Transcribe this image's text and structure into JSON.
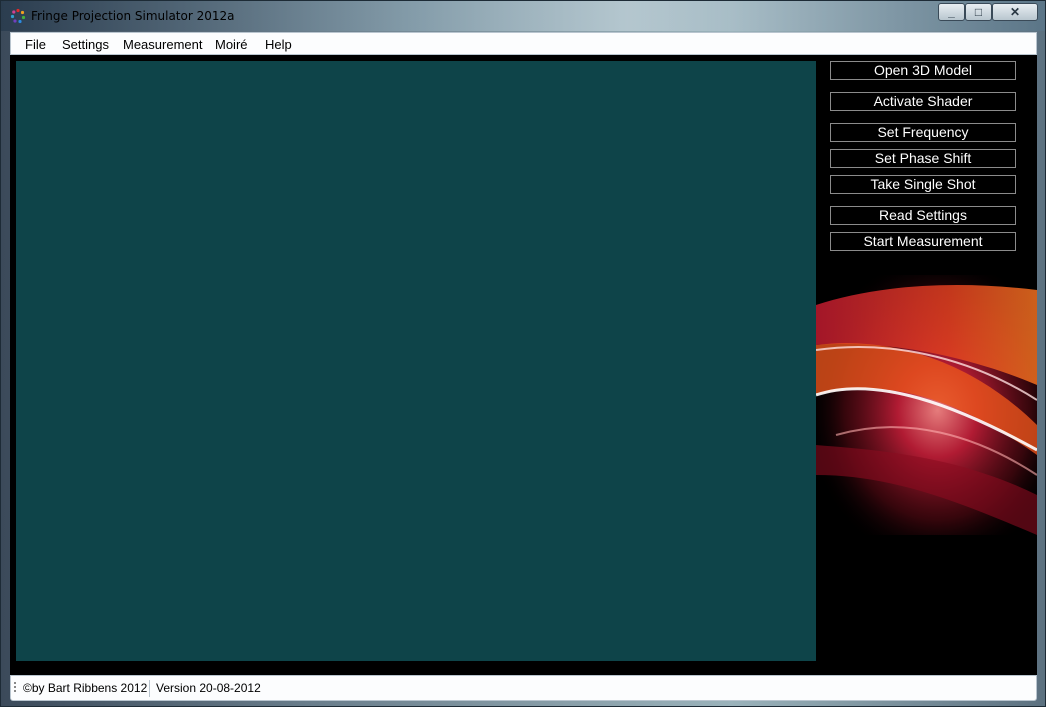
{
  "window": {
    "title": "Fringe Projection Simulator 2012a",
    "controls": {
      "minimize_icon": "minimize-icon",
      "maximize_icon": "maximize-icon",
      "close_icon": "close-icon"
    }
  },
  "menu": {
    "items": [
      {
        "label": "File"
      },
      {
        "label": "Settings"
      },
      {
        "label": "Measurement"
      },
      {
        "label": "Moiré"
      },
      {
        "label": "Help"
      }
    ]
  },
  "viewport": {
    "color": "#0e4449"
  },
  "buttons": [
    {
      "label": "Open 3D Model"
    },
    {
      "label": "Activate Shader"
    },
    {
      "label": "Set Frequency"
    },
    {
      "label": "Set Phase Shift"
    },
    {
      "label": "Take Single Shot"
    },
    {
      "label": "Read Settings"
    },
    {
      "label": "Start Measurement"
    }
  ],
  "status": {
    "copyright": "©by Bart Ribbens 2012",
    "version": "Version 20-08-2012"
  },
  "colors": {
    "accent_red": "#d0203c",
    "accent_orange": "#e8541c"
  }
}
